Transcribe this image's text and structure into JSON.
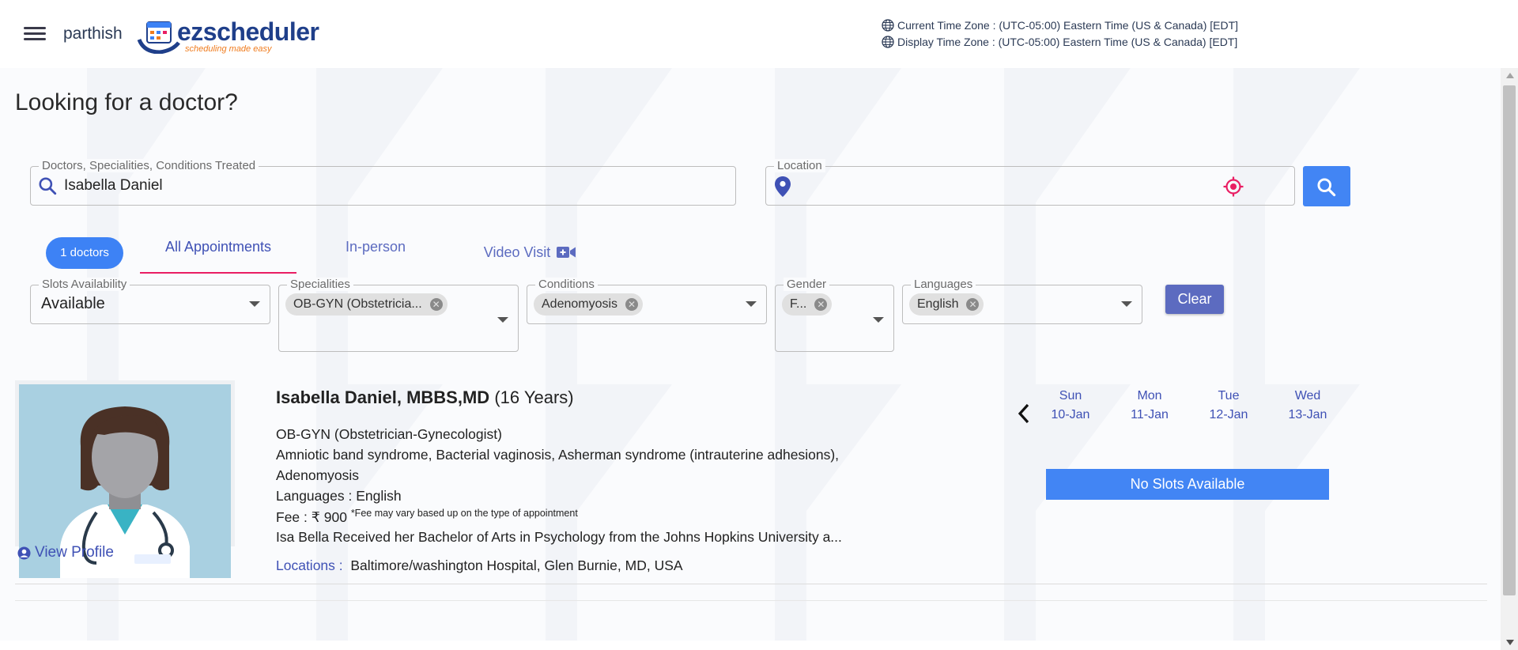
{
  "header": {
    "user_name": "parthish",
    "logo_text": "ezscheduler",
    "logo_tagline": "scheduling made easy",
    "current_timezone": "Current Time Zone : (UTC-05:00) Eastern Time (US & Canada) [EDT]",
    "display_timezone": "Display Time Zone : (UTC-05:00) Eastern Time (US & Canada) [EDT]"
  },
  "page": {
    "title": "Looking for a doctor?"
  },
  "search": {
    "query_label": "Doctors, Specialities, Conditions Treated",
    "query_value": "Isabella Daniel",
    "location_label": "Location",
    "location_value": ""
  },
  "tabs": {
    "count": "1 doctors",
    "items": [
      "All Appointments",
      "In-person",
      "Video Visit"
    ],
    "active": "All Appointments"
  },
  "filters": {
    "slots_label": "Slots Availability",
    "slots_value": "Available",
    "specialities_label": "Specialities",
    "specialities_chip": "OB-GYN (Obstetricia...",
    "conditions_label": "Conditions",
    "conditions_chip": "Adenomyosis",
    "gender_label": "Gender",
    "gender_chip": "F...",
    "languages_label": "Languages",
    "languages_chip": "English",
    "clear_label": "Clear"
  },
  "doctor": {
    "name": "Isabella Daniel, MBBS,MD",
    "experience": "(16 Years)",
    "speciality": "OB-GYN (Obstetrician-Gynecologist)",
    "conditions_line1": "Amniotic band syndrome, Bacterial vaginosis, Asherman syndrome (intrauterine adhesions),",
    "conditions_line2": "Adenomyosis",
    "languages": "Languages : English",
    "fee": "Fee : ₹ 900",
    "fee_note": "*Fee may vary based up on the type of appointment",
    "bio": "Isa Bella Received her Bachelor of Arts in Psychology from the Johns Hopkins University a...",
    "locations_label": "Locations :",
    "locations_value": "Baltimore/washington Hospital, Glen Burnie, MD, USA",
    "view_profile": "View Profile"
  },
  "calendar": {
    "days": [
      {
        "dow": "Sun",
        "date": "10-Jan"
      },
      {
        "dow": "Mon",
        "date": "11-Jan"
      },
      {
        "dow": "Tue",
        "date": "12-Jan"
      },
      {
        "dow": "Wed",
        "date": "13-Jan"
      }
    ],
    "no_slots": "No Slots Available"
  },
  "colors": {
    "primary": "#3f51b5",
    "button_blue": "#4285f4",
    "tab_indicator": "#e91e63",
    "locate_icon": "#e91e63"
  }
}
